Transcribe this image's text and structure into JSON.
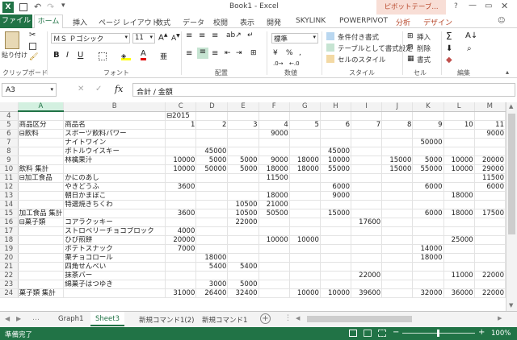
{
  "window": {
    "title": "Book1 - Excel",
    "pivot_tools": "ピボットテーブ...",
    "help": "?"
  },
  "ribbon_tabs": [
    "ファイル",
    "ホーム",
    "挿入",
    "ページ レイアウト",
    "数式",
    "データ",
    "校閲",
    "表示",
    "開発",
    "SKYLINK",
    "POWERPIVOT",
    "分析",
    "デザイン"
  ],
  "ribbon": {
    "paste": "貼り付け",
    "font_name": "ＭＳ Ｐゴシック",
    "font_size": "11",
    "number_format": "標準",
    "cond_format": "条件付き書式",
    "table_format": "テーブルとして書式設定",
    "cell_styles": "セルのスタイル",
    "insert": "挿入",
    "delete": "削除",
    "format": "書式",
    "groups": [
      "クリップボード",
      "フォント",
      "配置",
      "数値",
      "スタイル",
      "セル",
      "編集"
    ]
  },
  "formula_bar": {
    "name_box": "A3",
    "fx": "fx",
    "content": "合計 / 金額"
  },
  "columns": [
    "A",
    "B",
    "C",
    "D",
    "E",
    "F",
    "G",
    "H",
    "I",
    "J",
    "K",
    "L",
    "M"
  ],
  "rows": [
    {
      "n": "4",
      "c": [
        "",
        "",
        "⊟2015",
        "",
        "",
        "",
        "",
        "",
        "",
        "",
        "",
        "",
        ""
      ]
    },
    {
      "n": "5",
      "c": [
        "商品区分",
        "商品名",
        "1",
        "2",
        "3",
        "4",
        "5",
        "6",
        "7",
        "8",
        "9",
        "10",
        "11"
      ]
    },
    {
      "n": "6",
      "c": [
        "⊟飲料",
        "スポーツ飲料パワー",
        "",
        "",
        "",
        "9000",
        "",
        "",
        "",
        "",
        "",
        "",
        "9000"
      ]
    },
    {
      "n": "7",
      "c": [
        "",
        "ナイトワイン",
        "",
        "",
        "",
        "",
        "",
        "",
        "",
        "",
        "50000",
        "",
        ""
      ]
    },
    {
      "n": "8",
      "c": [
        "",
        "ボトルウイスキー",
        "",
        "45000",
        "",
        "",
        "",
        "45000",
        "",
        "",
        "",
        "",
        ""
      ]
    },
    {
      "n": "9",
      "c": [
        "",
        "林檎果汁",
        "10000",
        "5000",
        "5000",
        "9000",
        "18000",
        "10000",
        "",
        "15000",
        "5000",
        "10000",
        "20000"
      ]
    },
    {
      "n": "10",
      "c": [
        "飲料 集計",
        "",
        "10000",
        "50000",
        "5000",
        "18000",
        "18000",
        "55000",
        "",
        "15000",
        "55000",
        "10000",
        "29000"
      ]
    },
    {
      "n": "11",
      "c": [
        "⊟加工食品",
        "かにのあし",
        "",
        "",
        "",
        "11500",
        "",
        "",
        "",
        "",
        "",
        "",
        "11500"
      ]
    },
    {
      "n": "12",
      "c": [
        "",
        "やきどうふ",
        "3600",
        "",
        "",
        "",
        "",
        "6000",
        "",
        "",
        "6000",
        "",
        "6000"
      ]
    },
    {
      "n": "13",
      "c": [
        "",
        "朝日かまぼこ",
        "",
        "",
        "",
        "18000",
        "",
        "9000",
        "",
        "",
        "",
        "18000",
        ""
      ]
    },
    {
      "n": "14",
      "c": [
        "",
        "特選焼きちくわ",
        "",
        "",
        "10500",
        "21000",
        "",
        "",
        "",
        "",
        "",
        "",
        ""
      ]
    },
    {
      "n": "15",
      "c": [
        "加工食品 集計",
        "",
        "3600",
        "",
        "10500",
        "50500",
        "",
        "15000",
        "",
        "",
        "6000",
        "18000",
        "17500"
      ]
    },
    {
      "n": "16",
      "c": [
        "⊟菓子類",
        "コアラクッキー",
        "",
        "",
        "22000",
        "",
        "",
        "",
        "17600",
        "",
        "",
        "",
        ""
      ]
    },
    {
      "n": "17",
      "c": [
        "",
        "ストロベリーチョコブロック",
        "4000",
        "",
        "",
        "",
        "",
        "",
        "",
        "",
        "",
        "",
        ""
      ]
    },
    {
      "n": "18",
      "c": [
        "",
        "ひび煎餅",
        "20000",
        "",
        "",
        "10000",
        "10000",
        "",
        "",
        "",
        "",
        "25000",
        ""
      ]
    },
    {
      "n": "19",
      "c": [
        "",
        "ポテトスナック",
        "7000",
        "",
        "",
        "",
        "",
        "",
        "",
        "",
        "14000",
        "",
        ""
      ]
    },
    {
      "n": "20",
      "c": [
        "",
        "栗チョコロール",
        "",
        "18000",
        "",
        "",
        "",
        "",
        "",
        "",
        "18000",
        "",
        ""
      ]
    },
    {
      "n": "21",
      "c": [
        "",
        "四角せんべい",
        "",
        "5400",
        "5400",
        "",
        "",
        "",
        "",
        "",
        "",
        "",
        ""
      ]
    },
    {
      "n": "22",
      "c": [
        "",
        "抹茶バー",
        "",
        "",
        "",
        "",
        "",
        "",
        "22000",
        "",
        "",
        "11000",
        "22000"
      ]
    },
    {
      "n": "23",
      "c": [
        "",
        "綿菓子はつゆき",
        "",
        "3000",
        "5000",
        "",
        "",
        "",
        "",
        "",
        "",
        "",
        ""
      ]
    },
    {
      "n": "24",
      "c": [
        "菓子類 集計",
        "",
        "31000",
        "26400",
        "32400",
        "",
        "10000",
        "10000",
        "39600",
        "",
        "32000",
        "36000",
        "22000"
      ]
    }
  ],
  "sheet_tabs": [
    "Graph1",
    "Sheet3",
    "新規コマンド1(2)",
    "新規コマンド1"
  ],
  "active_sheet": "Sheet3",
  "status": {
    "ready": "準備完了",
    "zoom": "100%"
  },
  "colors": {
    "excel_green": "#217346",
    "pivot_tab": "#b7472a"
  }
}
